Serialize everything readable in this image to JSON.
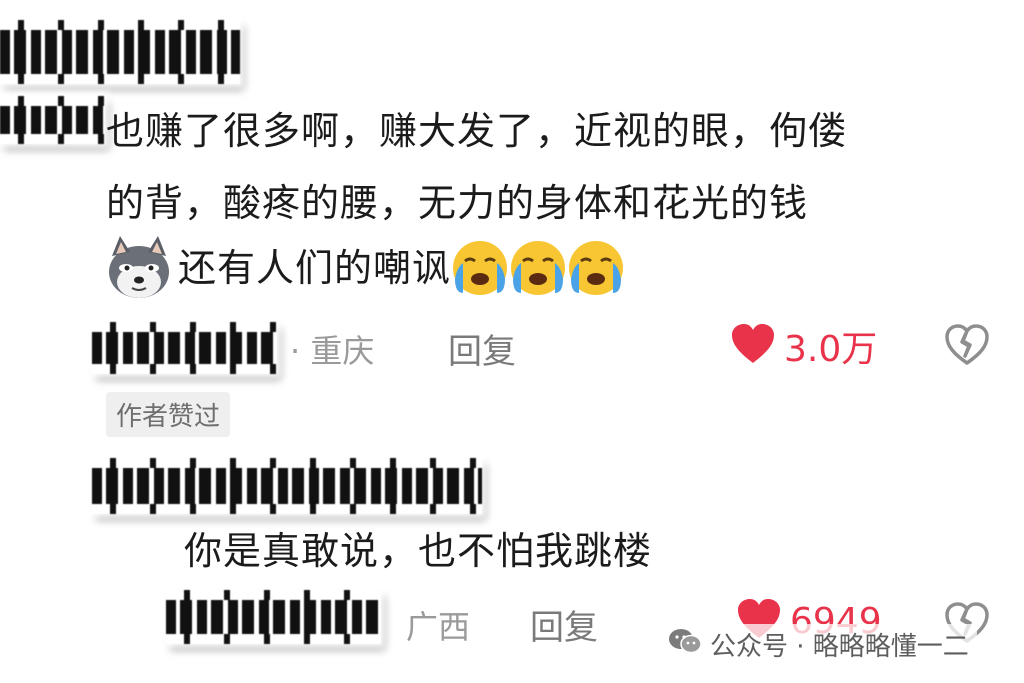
{
  "comment1": {
    "line1": "也赚了很多啊，赚大发了，近视的眼，佝偻",
    "line2": "的背，酸疼的腰，无力的身体和花光的钱",
    "line3": "还有人们的嘲讽",
    "location": "· 重庆",
    "reply_label": "回复",
    "likes": "3.0万",
    "author_liked_badge": "作者赞过"
  },
  "comment2": {
    "text": "你是真敢说，也不怕我跳楼",
    "location": "广西",
    "reply_label": "回复",
    "likes": "6949"
  },
  "watermark": {
    "text": "公众号 · 略略略懂一二"
  },
  "colors": {
    "like_red": "#e8334a",
    "meta_gray": "#9a9a9a",
    "text_dark": "#1b1b1b"
  },
  "icons": [
    "wolf-emoji-icon",
    "crying-face-icon",
    "heart-icon",
    "broken-heart-icon",
    "wechat-icon"
  ]
}
